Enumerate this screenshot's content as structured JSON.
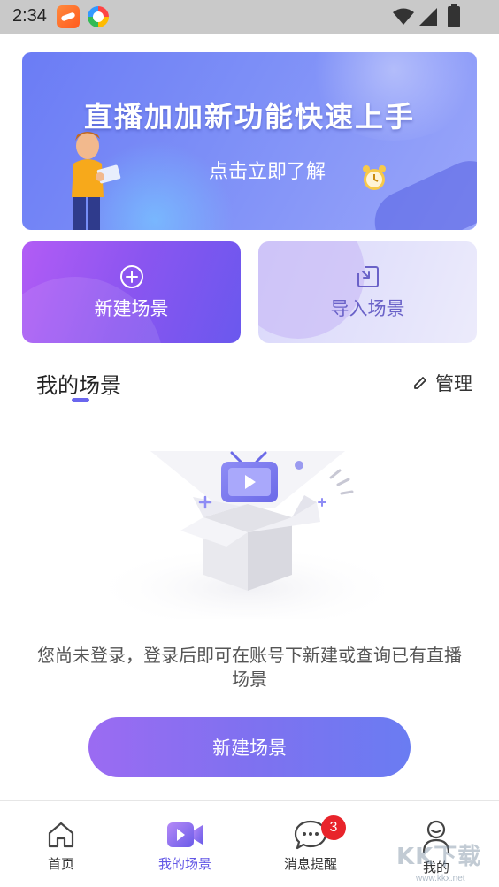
{
  "status_bar": {
    "time": "2:34"
  },
  "banner": {
    "title": "直播加加新功能快速上手",
    "subtitle": "点击立即了解"
  },
  "actions": {
    "new_scene_label": "新建场景",
    "import_scene_label": "导入场景"
  },
  "section": {
    "title": "我的场景",
    "manage_label": "管理"
  },
  "empty_state": {
    "message": "您尚未登录，登录后即可在账号下新建或查询已有直播场景",
    "button_label": "新建场景"
  },
  "bottom_nav": {
    "items": [
      {
        "label": "首页",
        "icon": "home-icon",
        "active": false
      },
      {
        "label": "我的场景",
        "icon": "video-camera-icon",
        "active": true
      },
      {
        "label": "消息提醒",
        "icon": "chat-bubble-icon",
        "active": false,
        "badge": "3"
      },
      {
        "label": "我的",
        "icon": "profile-icon",
        "active": false
      }
    ]
  },
  "watermark": {
    "text": "KK下载",
    "url": "www.kkx.net"
  },
  "colors": {
    "accent": "#6a66ee",
    "badge": "#e8242b",
    "banner_start": "#6b7cf5",
    "card_new_start": "#b25cf5"
  }
}
